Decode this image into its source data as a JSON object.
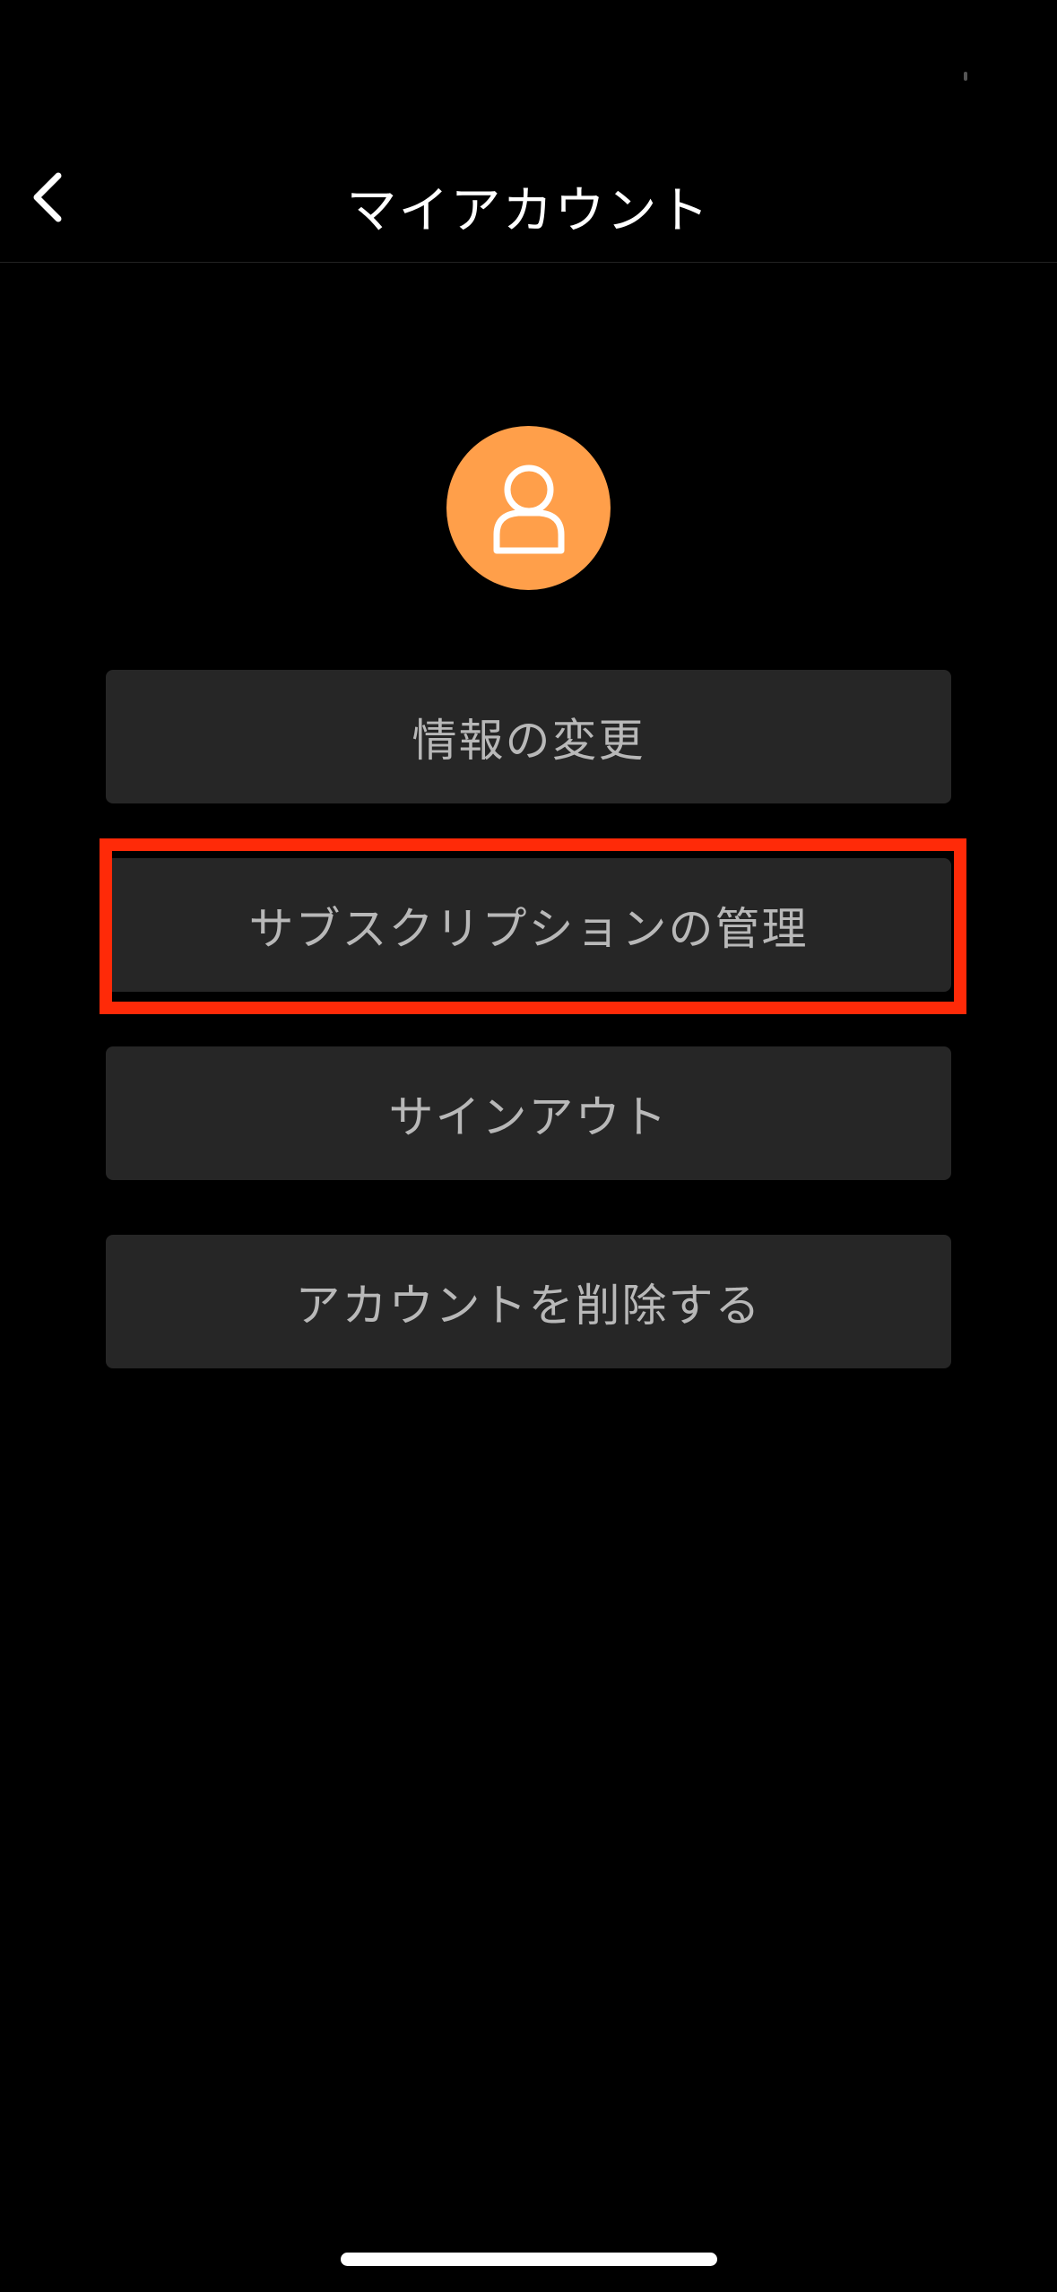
{
  "header": {
    "title": "マイアカウント",
    "back_icon": "chevron-left-icon"
  },
  "profile": {
    "avatar_icon": "user-icon",
    "avatar_color": "#FF9F4A"
  },
  "menu": {
    "edit_info": "情報の変更",
    "manage_subscription": "サブスクリプションの管理",
    "sign_out": "サインアウト",
    "delete_account": "アカウントを削除する"
  },
  "colors": {
    "background": "#000000",
    "button_bg": "#262626",
    "button_text": "#B8B8B8",
    "highlight": "#FF2A08"
  }
}
